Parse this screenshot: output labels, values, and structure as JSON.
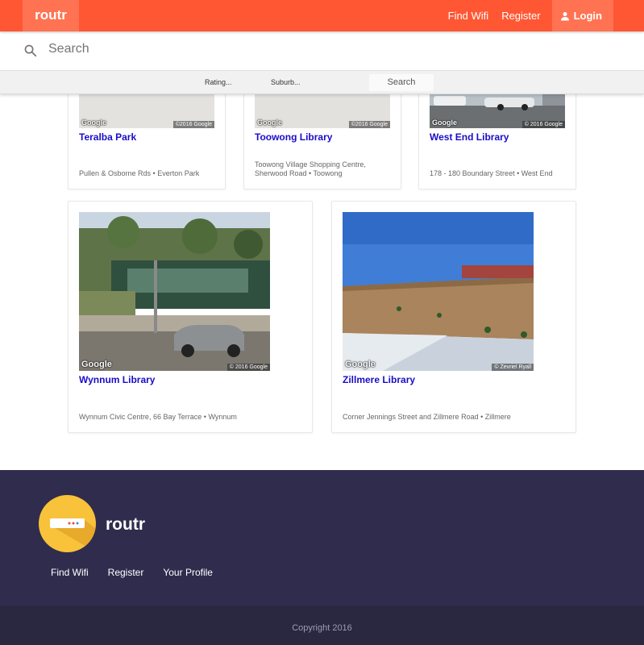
{
  "nav": {
    "brand": "routr",
    "links": [
      "Find Wifi",
      "Register"
    ],
    "login": "Login"
  },
  "search": {
    "placeholder": "Search"
  },
  "filters": {
    "rating": "Rating...",
    "suburb": "Suburb...",
    "button": "Search"
  },
  "cards": [
    {
      "title": "Teralba Park",
      "address": "Pullen & Osborne Rds • Everton Park",
      "google": "Google",
      "credit": "©2016 Google"
    },
    {
      "title": "Toowong Library",
      "address_line1": "Toowong Village Shopping Centre,",
      "address_line2": "Sherwood Road • Toowong",
      "google": "Google",
      "credit": "©2016 Google"
    },
    {
      "title": "West End Library",
      "address": "178 - 180 Boundary Street • West End",
      "google": "Google",
      "credit": "© 2016 Google"
    },
    {
      "title": "Wynnum Library",
      "address": "Wynnum Civic Centre, 66 Bay Terrace • Wynnum",
      "google": "Google",
      "credit": "© 2016 Google"
    },
    {
      "title": "Zillmere Library",
      "address": "Corner Jennings Street and Zillmere Road • Zillmere",
      "google": "Google",
      "credit": "© Zevriel Ryall"
    }
  ],
  "footer": {
    "brand": "routr",
    "links": [
      "Find Wifi",
      "Register",
      "Your Profile"
    ],
    "copyright": "Copyright 2016"
  },
  "colors": {
    "primary": "#ff5733",
    "link": "#1a0dc7",
    "footer": "#302c4d",
    "logo": "#f8c23a"
  }
}
